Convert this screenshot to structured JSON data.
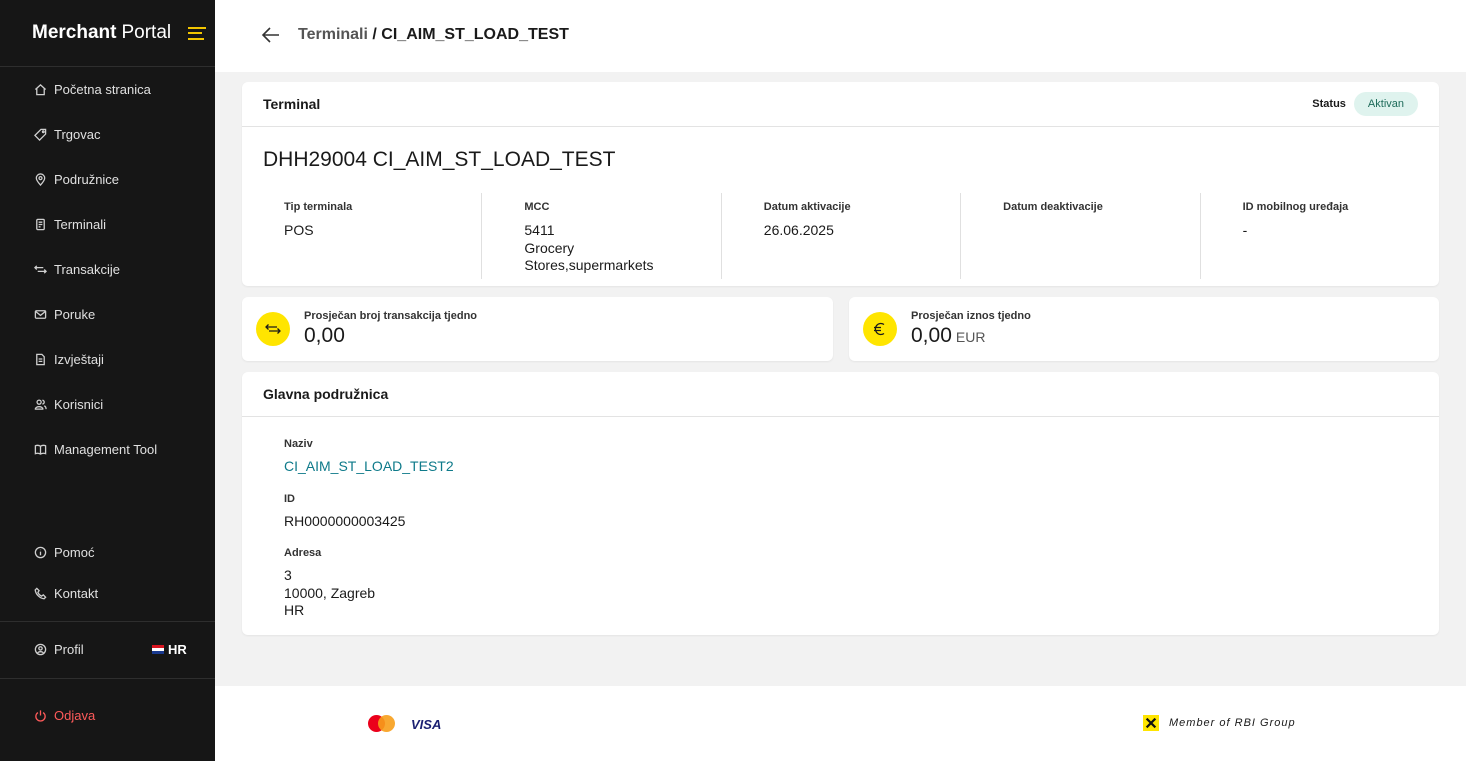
{
  "brand": {
    "bold": "Merchant",
    "regular": "Portal"
  },
  "sidebar": {
    "items": [
      {
        "label": "Početna stranica",
        "icon": "home-icon"
      },
      {
        "label": "Trgovac",
        "icon": "tag-icon"
      },
      {
        "label": "Podružnice",
        "icon": "map-pin-icon"
      },
      {
        "label": "Terminali",
        "icon": "terminal-icon"
      },
      {
        "label": "Transakcije",
        "icon": "arrows-icon"
      },
      {
        "label": "Poruke",
        "icon": "mail-icon"
      },
      {
        "label": "Izvještaji",
        "icon": "document-icon"
      },
      {
        "label": "Korisnici",
        "icon": "users-icon"
      },
      {
        "label": "Management Tool",
        "icon": "book-icon"
      }
    ],
    "bottom": [
      {
        "label": "Pomoć",
        "icon": "info-icon"
      },
      {
        "label": "Kontakt",
        "icon": "phone-icon"
      }
    ],
    "profile": {
      "label": "Profil",
      "icon": "profile-icon"
    },
    "language": "HR",
    "logout": {
      "label": "Odjava",
      "icon": "power-icon"
    }
  },
  "header": {
    "crumb_parent": "Terminali",
    "crumb_sep": " / ",
    "crumb_current": "CI_AIM_ST_LOAD_TEST"
  },
  "terminal_card": {
    "heading": "Terminal",
    "status_label": "Status",
    "status_value": "Aktivan",
    "title": "DHH29004 CI_AIM_ST_LOAD_TEST",
    "fields": [
      {
        "label": "Tip terminala",
        "value": "POS"
      },
      {
        "label": "MCC",
        "value": "5411\nGrocery\nStores,supermarkets"
      },
      {
        "label": "Datum aktivacije",
        "value": "26.06.2025"
      },
      {
        "label": "Datum deaktivacije",
        "value": ""
      },
      {
        "label": "ID mobilnog uređaja",
        "value": "-"
      }
    ]
  },
  "stats": {
    "transactions": {
      "label": "Prosječan broj transakcija tjedno",
      "value": "0,00"
    },
    "amount": {
      "label": "Prosječan iznos tjedno",
      "value": "0,00",
      "unit": "EUR"
    }
  },
  "branch_card": {
    "heading": "Glavna podružnica",
    "name_label": "Naziv",
    "name_value": "CI_AIM_ST_LOAD_TEST2",
    "id_label": "ID",
    "id_value": "RH0000000003425",
    "address_label": "Adresa",
    "address_lines": [
      "3",
      "10000, Zagreb",
      "HR"
    ]
  },
  "footer": {
    "visa": "VISA",
    "rbi_text": "Member of RBI Group"
  },
  "colors": {
    "sidebar_bg": "#161616",
    "accent_yellow": "#ffe500",
    "status_bg": "#dff3ee",
    "link": "#0e7a8a",
    "logout": "#ff5a5a"
  }
}
